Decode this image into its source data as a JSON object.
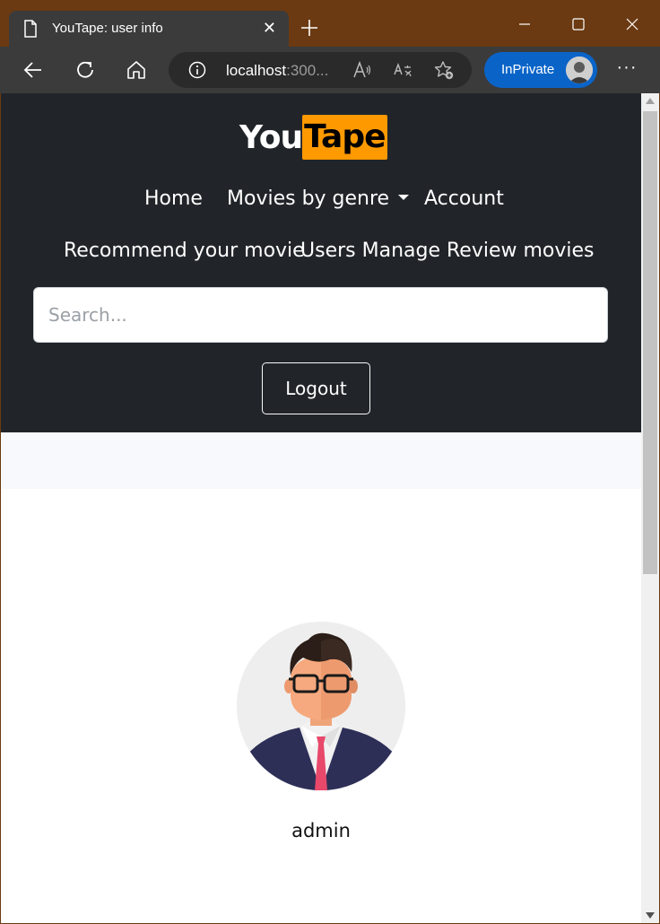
{
  "browser": {
    "tab_title": "YouTape: user info",
    "url_host": "localhost",
    "url_rest": ":300...",
    "inprivate_label": "InPrivate"
  },
  "brand": {
    "part1": "You",
    "part2": "Tape"
  },
  "nav": {
    "home": "Home",
    "movies_by_genre": "Movies by genre",
    "account": "Account",
    "recommend": "Recommend your movie",
    "users_manage": "Users Manage",
    "review_movies": "Review movies"
  },
  "search": {
    "placeholder": "Search..."
  },
  "logout_label": "Logout",
  "profile": {
    "username": "admin"
  },
  "colors": {
    "navbar_bg": "#212529",
    "brand_accent": "#ff9900",
    "inprivate_blue": "#0a64c8"
  }
}
